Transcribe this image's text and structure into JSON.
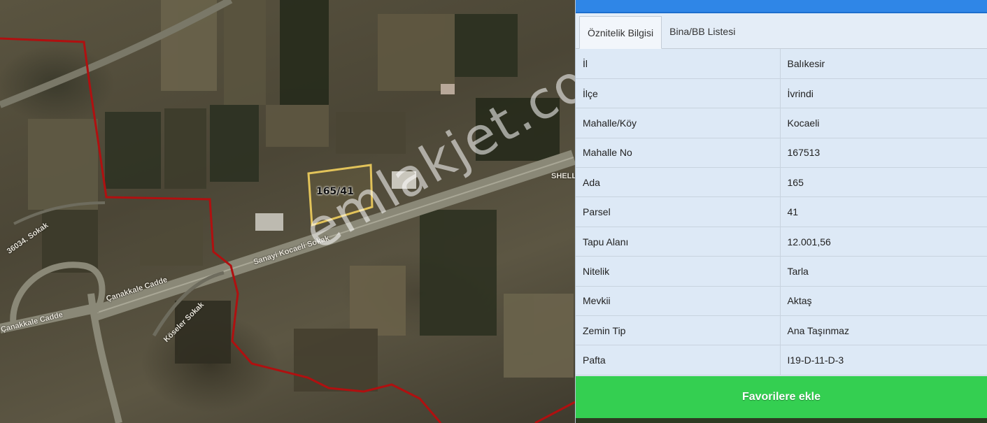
{
  "map": {
    "parcel_label": "165/41",
    "watermark": "emlakjet.com",
    "streets": {
      "sanayi_kocaeli": "Sanayi Kocaeli Sokak",
      "canakkale_1": "Çanakkale Cadde",
      "canakkale_2": "Çanakkale Cadde",
      "koseler": "Köseler Sokak",
      "s36034": "36034. Sokak",
      "shell": "SHELL"
    }
  },
  "panel": {
    "tabs": [
      {
        "label": "Öznitelik Bilgisi",
        "active": true
      },
      {
        "label": "Bina/BB Listesi",
        "active": false
      }
    ],
    "rows": [
      {
        "key": "İl",
        "value": "Balıkesir"
      },
      {
        "key": "İlçe",
        "value": "İvrindi"
      },
      {
        "key": "Mahalle/Köy",
        "value": "Kocaeli"
      },
      {
        "key": "Mahalle No",
        "value": "167513"
      },
      {
        "key": "Ada",
        "value": "165"
      },
      {
        "key": "Parsel",
        "value": "41"
      },
      {
        "key": "Tapu Alanı",
        "value": "12.001,56"
      },
      {
        "key": "Nitelik",
        "value": "Tarla"
      },
      {
        "key": "Mevkii",
        "value": "Aktaş"
      },
      {
        "key": "Zemin Tip",
        "value": "Ana Taşınmaz"
      },
      {
        "key": "Pafta",
        "value": "I19-D-11-D-3"
      }
    ],
    "favorite_button": "Favorilere ekle"
  },
  "colors": {
    "topbar": "#2f86e7",
    "button": "#34cf51",
    "boundary": "#b01010",
    "parcel": "#e2c35a"
  }
}
